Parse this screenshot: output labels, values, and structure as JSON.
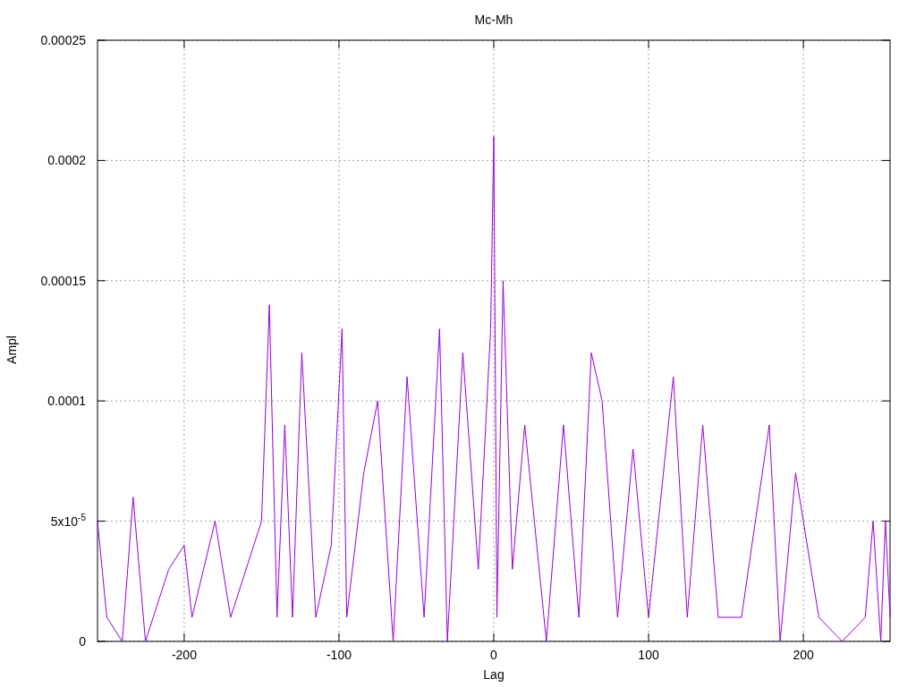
{
  "plot": {
    "chart_data": {
      "type": "line",
      "title": "Mc-Mh",
      "xlabel": "Lag",
      "ylabel": "Ampl",
      "xlim": [
        -256,
        256
      ],
      "ylim": [
        0,
        0.00025
      ],
      "xticks": [
        {
          "value": -200,
          "label": "-200"
        },
        {
          "value": -100,
          "label": "-100"
        },
        {
          "value": 0,
          "label": "0"
        },
        {
          "value": 100,
          "label": "100"
        },
        {
          "value": 200,
          "label": "200"
        }
      ],
      "yticks": [
        {
          "value": 0,
          "label": "0"
        },
        {
          "value": 5e-05,
          "label": "5x10$^{-5}$"
        },
        {
          "value": 0.0001,
          "label": "0.0001"
        },
        {
          "value": 0.00015,
          "label": "0.00015"
        },
        {
          "value": 0.0002,
          "label": "0.0002"
        },
        {
          "value": 0.00025,
          "label": "0.00025"
        }
      ],
      "x": [
        -256,
        -250,
        -240,
        -233,
        -225,
        -210,
        -200,
        -195,
        -180,
        -170,
        -150,
        -145,
        -140,
        -135,
        -130,
        -124,
        -115,
        -105,
        -98,
        -95,
        -84,
        -75,
        -65,
        -56,
        -45,
        -35,
        -30,
        -20,
        -10,
        -2,
        0,
        2,
        6,
        12,
        20,
        34,
        45,
        55,
        63,
        70,
        80,
        90,
        100,
        116,
        125,
        135,
        145,
        160,
        178,
        185,
        195,
        210,
        225,
        240,
        245,
        250,
        253,
        256
      ],
      "grid": true,
      "series": [
        {
          "color": "#9400d3",
          "values": [
            5e-05,
            1e-05,
            0,
            6e-05,
            0,
            3e-05,
            4e-05,
            1e-05,
            5e-05,
            1e-05,
            5e-05,
            0.00014,
            1e-05,
            9e-05,
            1e-05,
            0.00012,
            1e-05,
            4e-05,
            0.00013,
            1e-05,
            7e-05,
            0.0001,
            0,
            0.00011,
            1e-05,
            0.00013,
            0,
            0.00012,
            3e-05,
            0.00013,
            0.00021,
            1e-05,
            0.00015,
            3e-05,
            9e-05,
            0,
            9e-05,
            1e-05,
            0.00012,
            0.0001,
            1e-05,
            8e-05,
            1e-05,
            0.00011,
            1e-05,
            9e-05,
            1e-05,
            1e-05,
            9e-05,
            0,
            7e-05,
            1e-05,
            0,
            1e-05,
            5e-05,
            0,
            5e-05,
            1e-05
          ]
        }
      ]
    }
  }
}
